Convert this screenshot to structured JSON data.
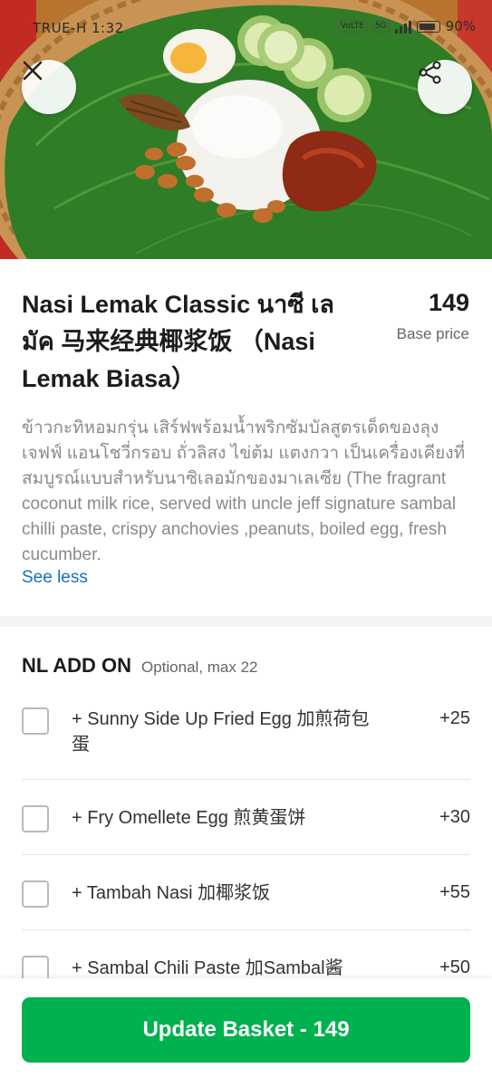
{
  "status_bar": {
    "carrier_time": "TRUE-H 1:32",
    "volte": "VoLTE",
    "network": "5G",
    "battery": "90%"
  },
  "hero": {
    "close_icon": "close-icon",
    "share_icon": "share-icon"
  },
  "item": {
    "title": "Nasi Lemak Classic นาซี เลมัค 马来经典椰浆饭 （Nasi Lemak Biasa）",
    "price": "149",
    "price_label": "Base price",
    "description": "ข้าวกะทิหอมกรุ่น เสิร์ฟพร้อมน้ำพริกซัมบัลสูตรเด็ดของลุงเจฟฟ์ แอนโชวี่กรอบ ถั่วลิสง ไข่ต้ม แตงกวา เป็นเครื่องเคียงที่สมบูรณ์แบบสำหรับนาซิเลอมักของมาเลเซีย (The fragrant coconut milk rice, served with uncle jeff signature sambal chilli paste, crispy anchovies ,peanuts, boiled egg, fresh cucumber.",
    "see_less": "See less"
  },
  "addon": {
    "title": "NL ADD ON",
    "subtitle": "Optional, max 22",
    "options": [
      {
        "label": "+ Sunny Side Up Fried Egg 加煎荷包蛋",
        "price": "+25"
      },
      {
        "label": "+ Fry Omellete Egg 煎黄蛋饼",
        "price": "+30"
      },
      {
        "label": "+ Tambah Nasi 加椰浆饭",
        "price": "+55"
      },
      {
        "label": "+ Sambal Chili Paste 加Sambal酱",
        "price": "+50"
      }
    ]
  },
  "footer": {
    "button_label": "Update Basket - 149"
  },
  "colors": {
    "accent_green": "#00b14f",
    "link_blue": "#1b6dc2"
  }
}
